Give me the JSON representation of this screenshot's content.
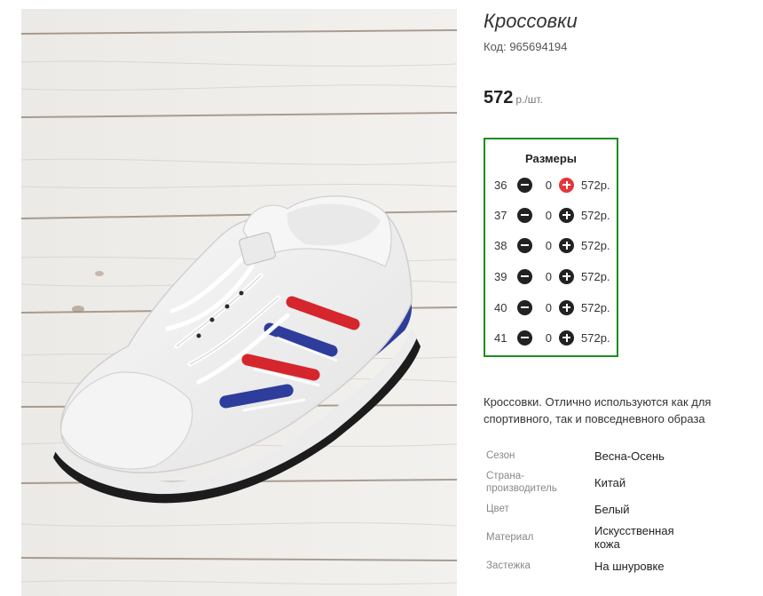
{
  "product": {
    "image_alt": "sneaker-photo",
    "title": "Кроссовки",
    "sku": "Код: 965694194",
    "price_value": "572",
    "price_unit": "р./шт."
  },
  "sizes": {
    "title": "Размеры",
    "items": [
      {
        "size": "36",
        "qty": "0",
        "price": "572р."
      },
      {
        "size": "37",
        "qty": "0",
        "price": "572р."
      },
      {
        "size": "38",
        "qty": "0",
        "price": "572р."
      },
      {
        "size": "39",
        "qty": "0",
        "price": "572р."
      },
      {
        "size": "40",
        "qty": "0",
        "price": "572р."
      },
      {
        "size": "41",
        "qty": "0",
        "price": "572р."
      }
    ]
  },
  "description": "Кроссовки. Отлично используются как для спортивного, так и повседневного образа",
  "properties": [
    {
      "name": "Сезон",
      "value": "Весна-Осень"
    },
    {
      "name": "Страна-производитель",
      "value": "Китай"
    },
    {
      "name": "Цвет",
      "value": "Белый"
    },
    {
      "name": "Материал",
      "value": "Искусственная кожа"
    },
    {
      "name": "Застежка",
      "value": "На шнуровке"
    }
  ],
  "colors": {
    "border_accent": "#1e8c1e",
    "plus_active": "#e2383b",
    "stripe_red": "#d4262c",
    "stripe_blue": "#2e3d9c"
  }
}
